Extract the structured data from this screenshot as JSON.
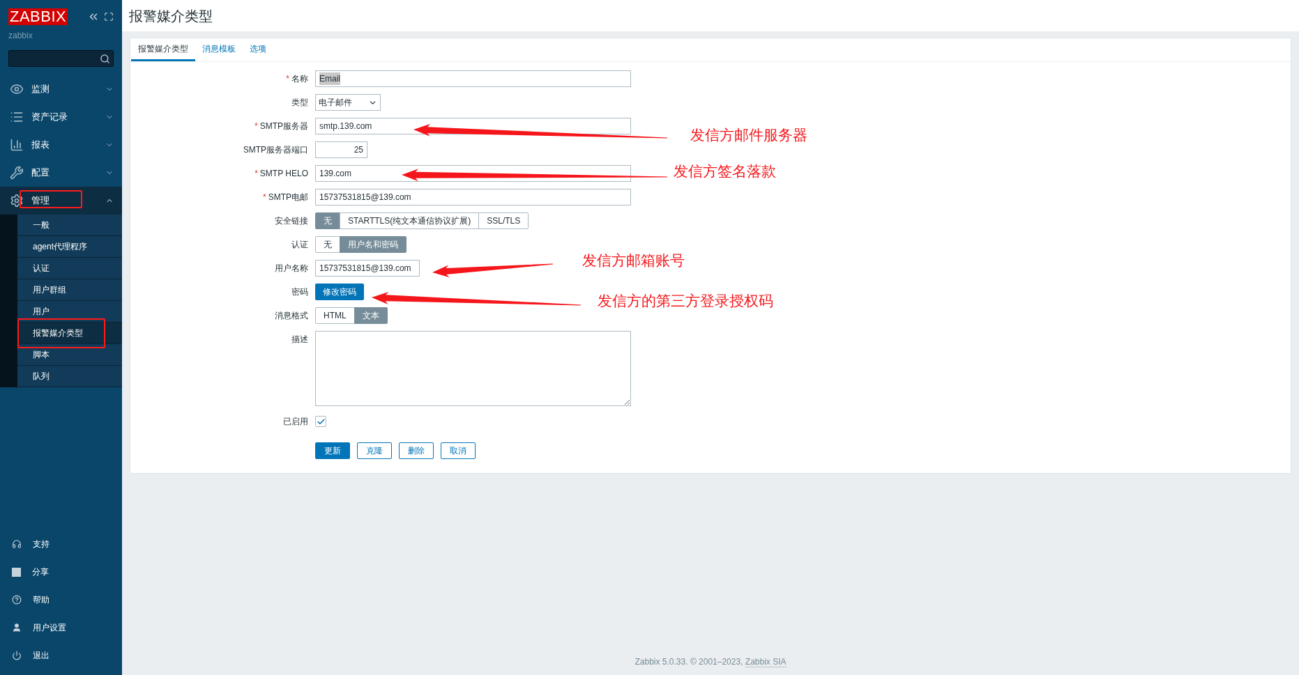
{
  "sidebar": {
    "logo": "ZABBIX",
    "server_name": "zabbix",
    "nav": [
      {
        "label": "监测",
        "expanded": false,
        "highlighted": false
      },
      {
        "label": "资产记录",
        "expanded": false,
        "highlighted": false
      },
      {
        "label": "报表",
        "expanded": false,
        "highlighted": false
      },
      {
        "label": "配置",
        "expanded": false,
        "highlighted": false
      },
      {
        "label": "管理",
        "expanded": true,
        "highlighted": true,
        "children": [
          {
            "label": "一般",
            "selected": false,
            "highlighted": false
          },
          {
            "label": "agent代理程序",
            "selected": false,
            "highlighted": false
          },
          {
            "label": "认证",
            "selected": false,
            "highlighted": false
          },
          {
            "label": "用户群组",
            "selected": false,
            "highlighted": false
          },
          {
            "label": "用户",
            "selected": false,
            "highlighted": false
          },
          {
            "label": "报警媒介类型",
            "selected": true,
            "highlighted": true
          },
          {
            "label": "脚本",
            "selected": false,
            "highlighted": false
          },
          {
            "label": "队列",
            "selected": false,
            "highlighted": false
          }
        ]
      }
    ],
    "bottom": [
      {
        "label": "支持"
      },
      {
        "label": "分享"
      },
      {
        "label": "帮助"
      },
      {
        "label": "用户设置"
      },
      {
        "label": "退出"
      }
    ]
  },
  "page_title": "报警媒介类型",
  "tabs": [
    {
      "label": "报警媒介类型",
      "selected": true
    },
    {
      "label": "消息模板",
      "selected": false
    },
    {
      "label": "选项",
      "selected": false
    }
  ],
  "form": [
    {
      "kind": "text",
      "label": "名称",
      "required_mark": "*",
      "value": "Email",
      "text_selected": true
    },
    {
      "kind": "select",
      "label": "类型",
      "value": "电子邮件"
    },
    {
      "kind": "text",
      "label": "SMTP服务器",
      "required_mark": "*",
      "value": "smtp.139.com"
    },
    {
      "kind": "text",
      "label": "SMTP服务器端口",
      "value": "25"
    },
    {
      "kind": "text",
      "label": "SMTP HELO",
      "required_mark": "*",
      "value": "139.com"
    },
    {
      "kind": "text",
      "label": "SMTP电邮",
      "required_mark": "*",
      "value": "15737531815@139.com"
    },
    {
      "kind": "segmented",
      "label": "安全链接",
      "options": [
        {
          "label": "无",
          "selected": true
        },
        {
          "label": "STARTTLS(纯文本通信协议扩展)",
          "selected": false
        },
        {
          "label": "SSL/TLS",
          "selected": false
        }
      ]
    },
    {
      "kind": "segmented",
      "label": "认证",
      "options": [
        {
          "label": "无",
          "selected": false
        },
        {
          "label": "用户名和密码",
          "selected": true
        }
      ]
    },
    {
      "kind": "text",
      "label": "用户名称",
      "value": "15737531815@139.com"
    },
    {
      "kind": "button",
      "label": "密码",
      "value": "修改密码"
    },
    {
      "kind": "segmented",
      "label": "消息格式",
      "options": [
        {
          "label": "HTML",
          "selected": false
        },
        {
          "label": "文本",
          "selected": true
        }
      ]
    },
    {
      "kind": "textarea",
      "label": "描述"
    },
    {
      "kind": "checkbox",
      "label": "已启用",
      "checked": true
    }
  ],
  "actions": [
    {
      "label": "更新",
      "primary": true
    },
    {
      "label": "克隆",
      "primary": false
    },
    {
      "label": "删除",
      "primary": false
    },
    {
      "label": "取消",
      "primary": false
    }
  ],
  "annotations": [
    {
      "text": "发信方邮件服务器"
    },
    {
      "text": "发信方签名落款"
    },
    {
      "text": "发信方邮箱账号"
    },
    {
      "text": "发信方的第三方登录授权码"
    }
  ],
  "footer": {
    "text": "Zabbix 5.0.33. © 2001–2023, ",
    "link": "Zabbix SIA"
  }
}
